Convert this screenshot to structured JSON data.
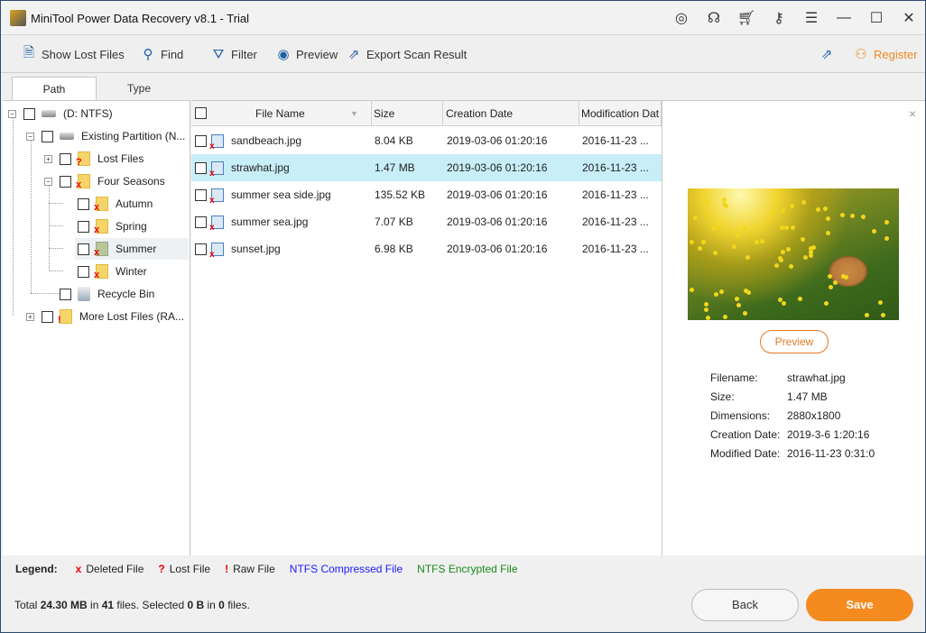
{
  "window": {
    "title": "MiniTool Power Data Recovery v8.1 - Trial",
    "title_icons": [
      "disc-icon",
      "support-headset-icon",
      "cart-icon",
      "key-icon",
      "menu-icon",
      "minimize-icon",
      "maximize-icon",
      "close-icon"
    ]
  },
  "toolbar": {
    "show_lost_files": "Show Lost Files",
    "find": "Find",
    "filter": "Filter",
    "preview": "Preview",
    "export": "Export Scan Result",
    "register": "Register"
  },
  "tabs": {
    "path": "Path",
    "type": "Type"
  },
  "tree": [
    {
      "label": "(D: NTFS)",
      "icon": "drive",
      "expander": "−"
    },
    {
      "label": "Existing Partition (N...",
      "icon": "drive",
      "expander": "−"
    },
    {
      "label": "Lost Files",
      "icon": "folder-lost",
      "marker": "?",
      "expander": "+"
    },
    {
      "label": "Four Seasons",
      "icon": "folder-deleted",
      "marker": "x",
      "expander": "−"
    },
    {
      "label": "Autumn",
      "icon": "folder-deleted",
      "marker": "x"
    },
    {
      "label": "Spring",
      "icon": "folder-deleted",
      "marker": "x"
    },
    {
      "label": "Summer",
      "icon": "folder-deleted",
      "marker": "x",
      "selected": true
    },
    {
      "label": "Winter",
      "icon": "folder-deleted",
      "marker": "x"
    },
    {
      "label": "Recycle Bin",
      "icon": "recycle-bin"
    },
    {
      "label": "More Lost Files (RA...",
      "icon": "folder-raw",
      "marker": "!",
      "expander": "+"
    }
  ],
  "filelist": {
    "columns": [
      "File Name",
      "Size",
      "Creation Date",
      "Modification Dat"
    ],
    "rows": [
      {
        "name": "sandbeach.jpg",
        "size": "8.04 KB",
        "created": "2019-03-06 01:20:16",
        "modified": "2016-11-23 ..."
      },
      {
        "name": "strawhat.jpg",
        "size": "1.47 MB",
        "created": "2019-03-06 01:20:16",
        "modified": "2016-11-23 ...",
        "selected": true
      },
      {
        "name": "summer sea side.jpg",
        "size": "135.52 KB",
        "created": "2019-03-06 01:20:16",
        "modified": "2016-11-23 ..."
      },
      {
        "name": "summer sea.jpg",
        "size": "7.07 KB",
        "created": "2019-03-06 01:20:16",
        "modified": "2016-11-23 ..."
      },
      {
        "name": "sunset.jpg",
        "size": "6.98 KB",
        "created": "2019-03-06 01:20:16",
        "modified": "2016-11-23 ..."
      }
    ]
  },
  "preview": {
    "button": "Preview",
    "close": "×",
    "info": [
      {
        "key": "Filename:",
        "value": "strawhat.jpg"
      },
      {
        "key": "Size:",
        "value": "1.47 MB"
      },
      {
        "key": "Dimensions:",
        "value": "2880x1800"
      },
      {
        "key": "Creation Date:",
        "value": "2019-3-6 1:20:16"
      },
      {
        "key": "Modified Date:",
        "value": "2016-11-23 0:31:0"
      }
    ]
  },
  "legend": {
    "label": "Legend:",
    "deleted": {
      "mark": "x",
      "text": "Deleted File"
    },
    "lost": {
      "mark": "?",
      "text": "Lost File"
    },
    "raw": {
      "mark": "!",
      "text": "Raw File"
    },
    "compressed": {
      "text": "NTFS Compressed File",
      "color": "#1a1aff"
    },
    "encrypted": {
      "text": "NTFS Encrypted File",
      "color": "#1a8a1a"
    }
  },
  "status": {
    "total_prefix": "Total ",
    "total_size": "24.30 MB",
    "in1": " in ",
    "total_files": "41",
    "files1": " files.  Selected ",
    "selected_size": "0 B",
    "in2": " in ",
    "selected_files": "0",
    "files2": " files."
  },
  "buttons": {
    "back": "Back",
    "save": "Save"
  },
  "colors": {
    "accent": "#f58a1f",
    "selection": "#c8eef8"
  }
}
